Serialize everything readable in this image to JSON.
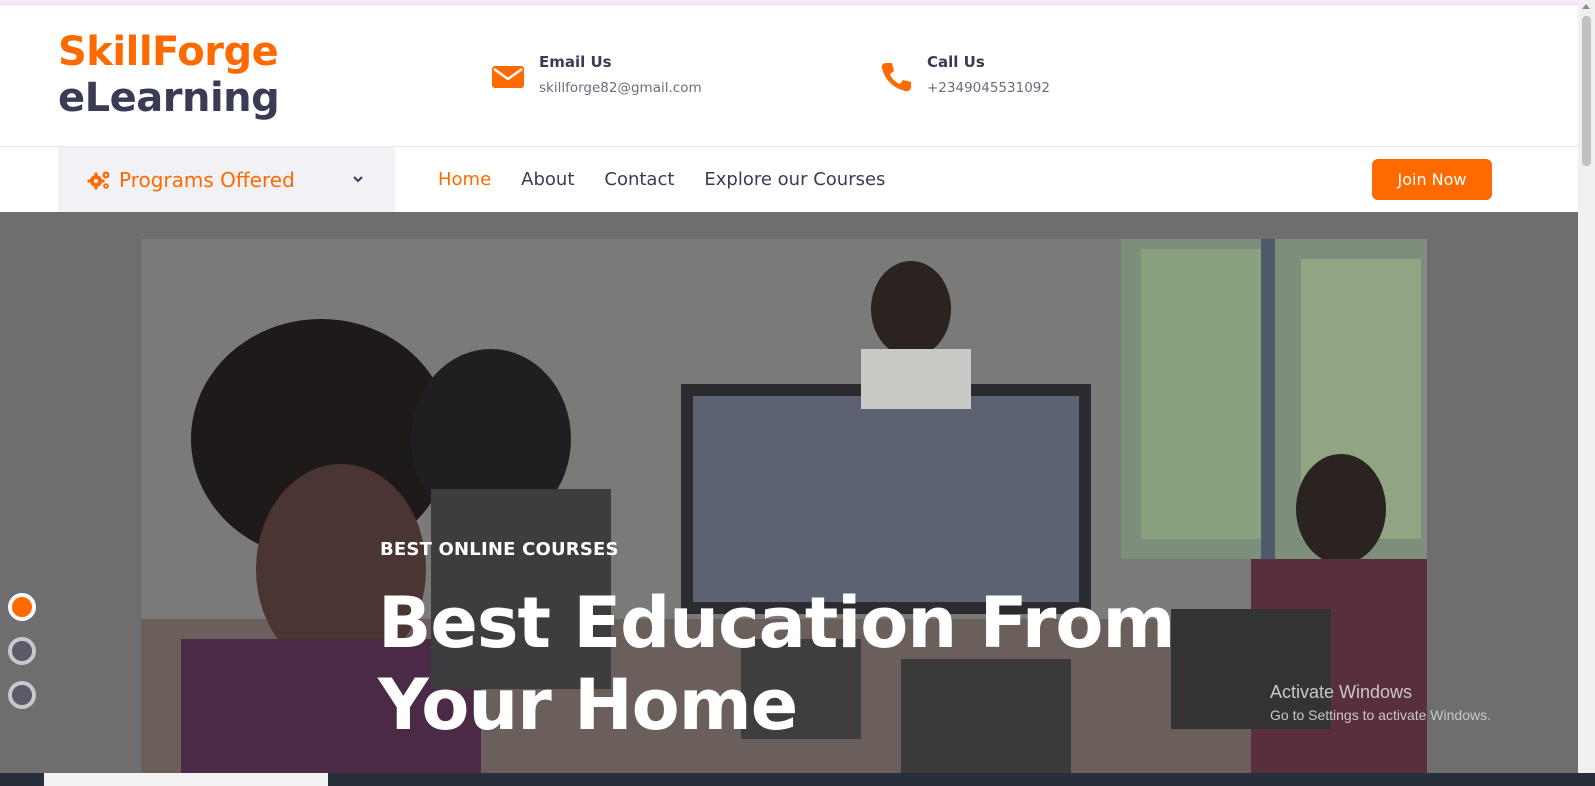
{
  "brand": {
    "line1": "SkillForge",
    "line2": "eLearning"
  },
  "contacts": [
    {
      "title": "Email Us",
      "value": "skillforge82@gmail.com",
      "icon": "envelope-icon"
    },
    {
      "title": "Call Us",
      "value": "+2349045531092",
      "icon": "phone-icon"
    }
  ],
  "nav": {
    "programs_label": "Programs Offered",
    "links": [
      "Home",
      "About",
      "Contact",
      "Explore our Courses"
    ],
    "active": "Home",
    "join_label": "Join Now"
  },
  "hero": {
    "eyebrow": "BEST ONLINE COURSES",
    "headline_line1": "Best Education From",
    "headline_line2": "Your Home",
    "slides_total": 3,
    "active_slide": 1
  },
  "os_watermark": {
    "line1": "Activate Windows",
    "line2": "Go to Settings to activate Windows."
  },
  "colors": {
    "accent": "#ff6a00",
    "dark": "#3a3b55",
    "hero_overlay": "#6e6e6e"
  }
}
